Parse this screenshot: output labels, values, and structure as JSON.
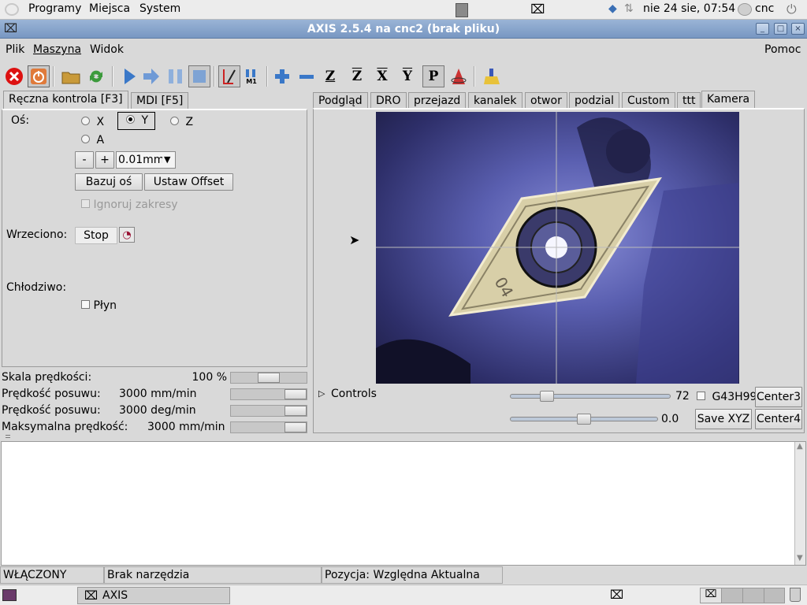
{
  "topbar": {
    "menus": [
      "Programy",
      "Miejsca",
      "System"
    ],
    "datetime": "nie 24 sie, 07:54",
    "user": "cnc"
  },
  "window": {
    "title": "AXIS 2.5.4 na cnc2 (brak pliku)"
  },
  "menubar": {
    "items": [
      "Plik",
      "Maszyna",
      "Widok"
    ],
    "help": "Pomoc"
  },
  "toolbar": {
    "icons": [
      "estop-icon",
      "power-icon",
      "open-icon",
      "reload-icon",
      "run-icon",
      "step-icon",
      "pause-icon",
      "stop-icon",
      "block-delete-icon",
      "optional-stop-icon",
      "zoom-in-icon",
      "zoom-out-icon",
      "view-z-icon",
      "view-z2-icon",
      "view-x-icon",
      "view-y-icon",
      "view-p-icon",
      "rotate-icon",
      "clear-icon"
    ],
    "view_letters": [
      "Z",
      "Z",
      "X",
      "Y",
      "P"
    ],
    "m1_label": "M1"
  },
  "left_tabs": [
    "Ręczna kontrola [F3]",
    "MDI [F5]"
  ],
  "manual": {
    "axis_label": "Oś:",
    "axes": [
      "X",
      "Y",
      "Z",
      "A"
    ],
    "selected_axis": "Y",
    "minus": "-",
    "plus": "+",
    "increment": "0.01mm",
    "home_button": "Bazuj oś",
    "offset_button": "Ustaw Offset",
    "ignore_limits": "Ignoruj zakresy",
    "spindle_label": "Wrzeciono:",
    "spindle_stop": "Stop",
    "coolant_label": "Chłodziwo:",
    "flood": "Płyn"
  },
  "sliders": [
    {
      "label": "Skala prędkości:",
      "value": "100 %",
      "position": 0.5
    },
    {
      "label": "Prędkość posuwu:",
      "value": "3000 mm/min",
      "position": 1.0
    },
    {
      "label": "Prędkość posuwu:",
      "value": "3000 deg/min",
      "position": 1.0
    },
    {
      "label": "Maksymalna prędkość:",
      "value": "3000 mm/min",
      "position": 1.0
    }
  ],
  "right_tabs": [
    "Podgląd",
    "DRO",
    "przejazd",
    "kanalek",
    "otwor",
    "podzial",
    "Custom",
    "ttt",
    "Kamera"
  ],
  "active_right_tab": "Kamera",
  "camera": {
    "controls_label": "Controls",
    "slider1_value": "72",
    "slider1_position": 0.2,
    "slider2_value": "0.0",
    "slider2_position": 0.5,
    "g43_label": "G43H99",
    "center3": "Center3",
    "save_xyz": "Save XYZ",
    "center4": "Center4"
  },
  "status": {
    "state": "WŁĄCZONY",
    "tool": "Brak narzędzia",
    "position": "Pozycja: Względna Aktualna"
  },
  "taskbar": {
    "app": "AXIS"
  }
}
